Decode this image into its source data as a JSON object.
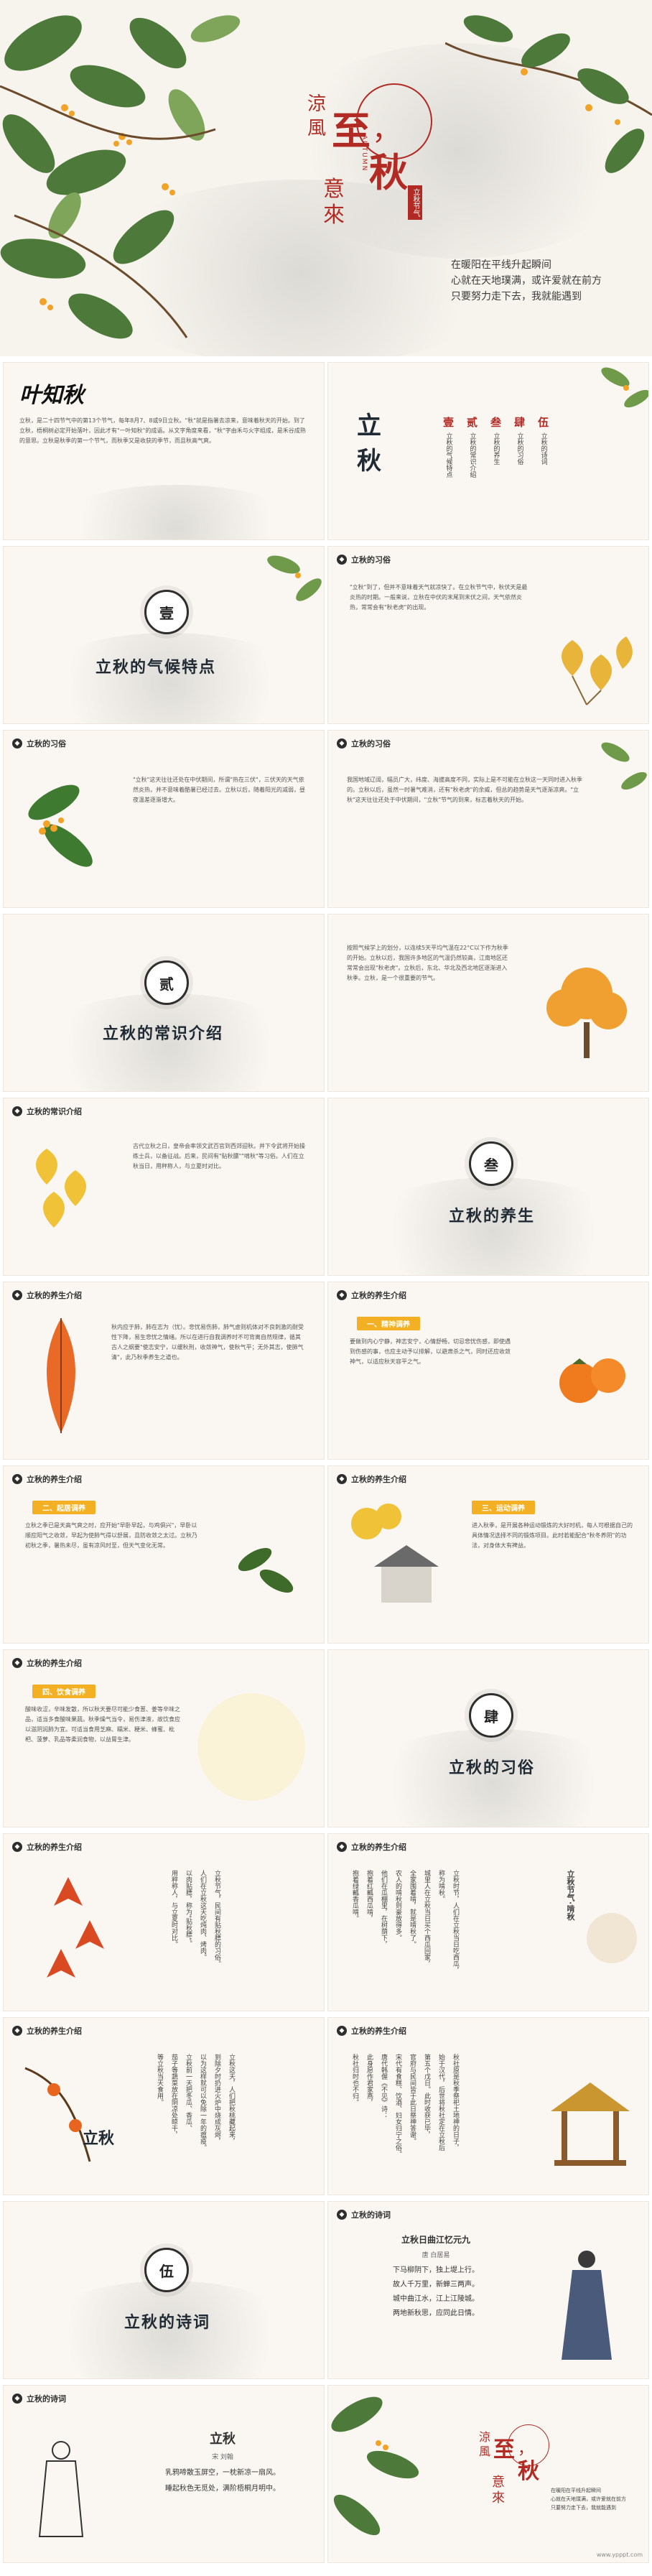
{
  "hero": {
    "title_chars": [
      "涼",
      "風",
      "至",
      "，",
      "秋",
      "意",
      "來"
    ],
    "seal_vertical": "立秋节气",
    "side_en": "AUTUMN",
    "lines": [
      "在暖阳在平线升起瞬间",
      "心就在天地璞满，或许爱就在前方",
      "只要努力走下去，我就能遇到"
    ]
  },
  "slides": [
    {
      "logo": "叶知秋",
      "body": "立秋，是二十四节气中的第13个节气，每年8月7、8或9日立秋。\"秋\"就是指暑去凉来，意味着秋天的开始。到了立秋，梧桐树必定开始落叶，因此才有\"一叶知秋\"的成语。从文字角度来看，\"秋\"字由禾与火字组成，是禾谷成熟的意思。立秋是秋季的第一个节气，而秋季又是收获的季节，而且秋高气爽。"
    },
    {
      "toc_seal": "立秋",
      "items": [
        {
          "num": "壹",
          "label": "立秋的气候特点"
        },
        {
          "num": "贰",
          "label": "立秋的常识介绍"
        },
        {
          "num": "叁",
          "label": "立秋的养生"
        },
        {
          "num": "肆",
          "label": "立秋的习俗"
        },
        {
          "num": "伍",
          "label": "立秋的诗词"
        }
      ]
    },
    {
      "num": "壹",
      "title": "立秋的气候特点"
    },
    {
      "header": "立秋的习俗",
      "body": "\"立秋\"到了，但并不意味着天气就凉快了。在立秋节气中，秋伏天是最炎热的时期。一般来说，立秋在中伏的末尾到末伏之间，天气依然炎热，常常会有\"秋老虎\"的出现。"
    },
    {
      "header": "立秋的习俗",
      "body": "\"立秋\"这天往往还处在中伏期间，所谓\"热在三伏\"，三伏天的天气依然炎热，并不意味着酷暑已经过去。立秋以后，随着阳光的减弱，昼夜温差逐渐增大。"
    },
    {
      "header": "立秋的习俗",
      "body": "我国地域辽阔，幅员广大，纬度、海拔高度不同，实际上是不可能在立秋这一天同时进入秋季的。立秋以后，虽然一时暑气难消，还有\"秋老虎\"的余威，但总的趋势是天气逐渐凉爽。\"立秋\"这天往往还处于中伏期间，\"立秋\"节气的到来，标志着秋天的开始。"
    },
    {
      "num": "贰",
      "title": "立秋的常识介绍"
    },
    {
      "header": "立秋的常识介绍",
      "body": "按照气候学上的划分，以连续5天平均气温在22°C以下作为秋季的开始。立秋以后，我国许多地区的气温仍然较高，江南地区还常常会出现\"秋老虎\"。立秋后，东北、华北及西北地区逐渐进入秋季。立秋，是一个很重要的节气。"
    },
    {
      "header": "立秋的常识介绍",
      "body": "古代立秋之日，皇帝会率领文武百官到西郊迎秋。并下令武将开始操练士兵，以备征战。后来，民间有\"贴秋膘\"\"啃秋\"等习俗。人们在立秋当日，用秤称人，与立夏时对比。"
    },
    {
      "num": "叁",
      "title": "立秋的养生"
    },
    {
      "header": "立秋的养生介绍",
      "body": "秋内应于肺，肺在志为（忧）。悲忧易伤肺，肺气虚则机体对不良刺激的耐受性下降，易生悲忧之情绪。所以在进行自我调养时不可背离自然规律，循其古人之纲要\"使志安宁，以缓秋刑，收敛神气，使秋气平；无外其志，使肺气清\"，此乃秋季养生之道也。"
    },
    {
      "header": "立秋的养生介绍",
      "pill": "一、精神调养",
      "body": "要做到内心宁静，神志安宁，心情舒畅，切忌悲忧伤感，即使遇到伤感的事，也应主动予以排解，以避肃杀之气，同时还应收敛神气，以适应秋天容平之气。"
    },
    {
      "header": "立秋的养生介绍",
      "pill": "二、起居调养",
      "body": "立秋之季已是天高气爽之时，应开始\"早卧早起，与鸡俱兴\"，早卧以顺应阳气之收敛，早起为使肺气得以舒展，且防收敛之太过。立秋乃初秋之季，暑热未尽，虽有凉风时至，但天气变化无常。"
    },
    {
      "header": "立秋的养生介绍",
      "pill": "三、运动调养",
      "body": "进入秋季，是开展各种运动锻炼的大好时机，每人可根据自己的具体情况选择不同的锻炼项目。此时若能配合\"秋冬养阴\"的功法，对身体大有裨益。"
    },
    {
      "header": "立秋的养生介绍",
      "pill": "四、饮食调养",
      "body": "酸味收涩，辛味发散，所以秋天要尽可能少食葱、姜等辛味之品，适当多食酸味果蔬。秋季燥气当令，易伤津液，故饮食应以滋阴润肺为宜。可适当食用芝麻、糯米、粳米、蜂蜜、枇杷、菠萝、乳品等柔润食物，以益胃生津。"
    },
    {
      "num": "肆",
      "title": "立秋的习俗"
    },
    {
      "header": "立秋的养生介绍",
      "columns": [
        "立秋节气，民间有贴秋膘的习俗。",
        "人们在立秋这天吃炖肉、烤肉。",
        "以肉贴膘，称为\"贴秋膘\"。",
        "用秤称人，与立夏时对比。"
      ]
    },
    {
      "header": "立秋的养生介绍",
      "vtitle": "立秋节气·啃秋",
      "columns": [
        "立秋时节，人们在立秋当日吃西瓜，",
        "称为啃秋。",
        "城里人在立秋当日买个西瓜回家，",
        "全家围着啃，就是啃秋了。",
        "农人的啃秋则豪放得多。",
        "他们在瓜棚里，在树荫下，",
        "抱着红瓤西瓜啃，",
        "抱着绿瓤香瓜啃。"
      ]
    },
    {
      "header": "立秋的养生介绍",
      "seal": "立秋",
      "columns": [
        "立秋这天，人们把秋桃藏起来，",
        "到除夕时扔进火炉中烧成灰烬，",
        "以为这样就可以免除一年的瘟疫。",
        "立秋前一天把冬瓜、香瓜、",
        "茄子等蔬菜放在阴凉处晾干，",
        "等立秋当天食用。"
      ]
    },
    {
      "header": "立秋的养生介绍",
      "columns": [
        "秋社原是秋季祭祀土地神的日子，",
        "始于汉代，后世将秋社定在立秋后",
        "第五个戊日。此时收获已毕，",
        "官府与民间皆于此日祭神答谢。",
        "宋代有食糕、饮酒、妇女归宁之俗。",
        "唐代韩偓《不见》诗：",
        "此身愿作君家燕，",
        "秋社归时也不归。"
      ]
    },
    {
      "num": "伍",
      "title": "立秋的诗词"
    },
    {
      "header": "立秋的诗词",
      "poem_title": "立秋日曲江忆元九",
      "author": "唐 白居易",
      "lines": [
        "下马柳阴下，独上堤上行。",
        "故人千万里，新蝉三两声。",
        "城中曲江水，江上江陵城。",
        "两地新秋思，应同此日情。"
      ]
    },
    {
      "header": "立秋的诗词",
      "poem_title": "立秋",
      "author": "宋 刘翰",
      "lines": [
        "乳鸦啼散玉屏空，一枕新凉一扇风。",
        "睡起秋色无觅处，满阶梧桐月明中。"
      ]
    },
    {
      "end_title_chars": [
        "涼",
        "風",
        "至",
        "，",
        "秋",
        "意",
        "來"
      ],
      "lines": [
        "在暖阳在平线升起瞬间",
        "心就在天地璞满，或许爱就在前方",
        "只要努力走下去，我就能遇到"
      ],
      "watermark": "www.ypppt.com"
    }
  ],
  "colors": {
    "ink": "#1f2a34",
    "red": "#b22a24",
    "gold": "#f3b024",
    "paper": "#faf7f2"
  }
}
